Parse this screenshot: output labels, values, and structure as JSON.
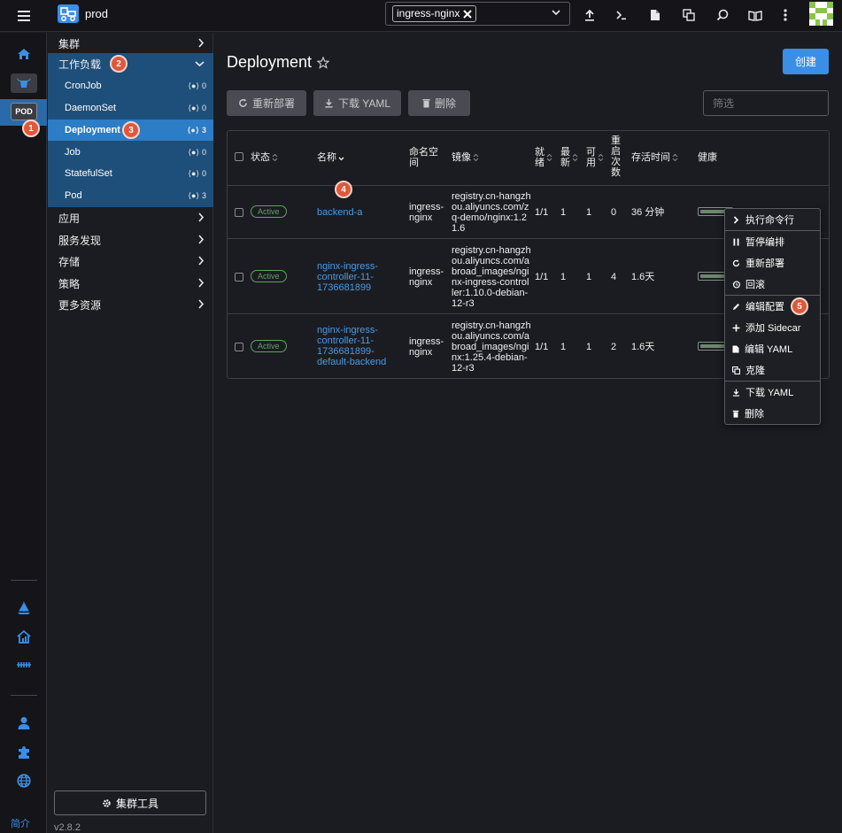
{
  "header": {
    "cluster_name": "prod",
    "namespace_chip": "ingress-nginx"
  },
  "rail": {
    "pod_label": "POD",
    "about": "简介"
  },
  "nav": {
    "cluster": "集群",
    "workloads": "工作负载",
    "sub": [
      {
        "label": "CronJob",
        "count": "0"
      },
      {
        "label": "DaemonSet",
        "count": "0"
      },
      {
        "label": "Deployment",
        "count": "3"
      },
      {
        "label": "Job",
        "count": "0"
      },
      {
        "label": "StatefulSet",
        "count": "0"
      },
      {
        "label": "Pod",
        "count": "3"
      }
    ],
    "groups": [
      "应用",
      "服务发现",
      "存储",
      "策略",
      "更多资源"
    ],
    "cluster_tools": "集群工具",
    "version": "v2.8.2"
  },
  "badges": [
    "1",
    "2",
    "3",
    "4",
    "5"
  ],
  "main": {
    "title": "Deployment",
    "create": "创建",
    "redeploy": "重新部署",
    "download_yaml": "下载 YAML",
    "delete": "删除",
    "filter_placeholder": "筛选"
  },
  "table": {
    "headers": {
      "status": "状态",
      "name": "名称",
      "namespace": [
        "命名空",
        "间"
      ],
      "image": "镜像",
      "ready": [
        "就",
        "绪"
      ],
      "updated": [
        "最",
        "新"
      ],
      "available": [
        "可",
        "用"
      ],
      "restarts": [
        "重",
        "启",
        "次",
        "数"
      ],
      "age": "存活时间",
      "health": "健康"
    },
    "rows": [
      {
        "status": "Active",
        "name": [
          "backend-a"
        ],
        "namespace": [
          "ingress-",
          "nginx"
        ],
        "image": [
          "registry.cn-hangzh",
          "ou.aliyuncs.com/z",
          "q-demo/nginx:1.2",
          "1.6"
        ],
        "ready": "1/1",
        "updated": "1",
        "available": "1",
        "restarts": "0",
        "age": "36 分钟",
        "health": 1.0
      },
      {
        "status": "Active",
        "name": [
          "nginx-ingress-",
          "controller-11-",
          "1736681899"
        ],
        "namespace": [
          "ingress-",
          "nginx"
        ],
        "image": [
          "registry.cn-hangzh",
          "ou.aliyuncs.com/a",
          "broad_images/ngi",
          "nx-ingress-control",
          "ler:1.10.0-debian-",
          "12-r3"
        ],
        "ready": "1/1",
        "updated": "1",
        "available": "1",
        "restarts": "4",
        "age": "1.6天",
        "health": 1.0
      },
      {
        "status": "Active",
        "name": [
          "nginx-ingress-",
          "controller-11-",
          "1736681899-",
          "default-backend"
        ],
        "namespace": [
          "ingress-",
          "nginx"
        ],
        "image": [
          "registry.cn-hangzh",
          "ou.aliyuncs.com/a",
          "broad_images/ngi",
          "nx:1.25.4-debian-",
          "12-r3"
        ],
        "ready": "1/1",
        "updated": "1",
        "available": "1",
        "restarts": "2",
        "age": "1.6天",
        "health": 1.0
      }
    ]
  },
  "context_menu": {
    "items": [
      "执行命令行",
      "暂停编排",
      "重新部署",
      "回滚",
      "编辑配置",
      "添加 Sidecar",
      "编辑 YAML",
      "克隆",
      "下载 YAML",
      "删除"
    ],
    "icons": [
      "chevron-right-icon",
      "pause-icon",
      "refresh-icon",
      "history-icon",
      "pencil-icon",
      "plus-icon",
      "file-icon",
      "copy-icon",
      "download-icon",
      "trash-icon"
    ]
  },
  "colors": {
    "accent": "#3a8ee6",
    "badge": "#e0573a",
    "active_status": "#5fa35f",
    "nav_group": "#1e4f7a",
    "nav_active": "#2c7cc6"
  }
}
